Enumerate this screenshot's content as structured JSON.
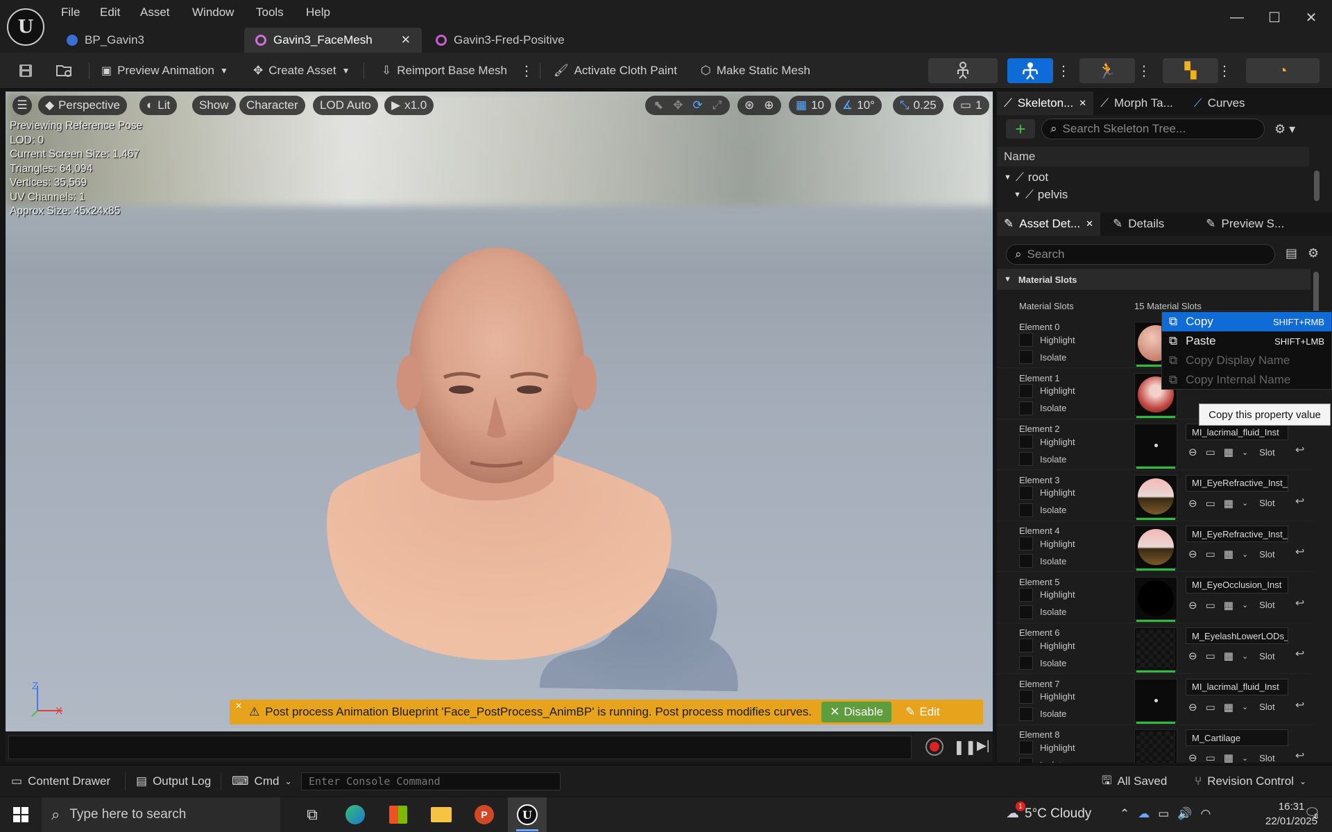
{
  "menu": {
    "file": "File",
    "edit": "Edit",
    "asset": "Asset",
    "window": "Window",
    "tools": "Tools",
    "help": "Help"
  },
  "tabs": [
    {
      "label": "BP_Gavin3"
    },
    {
      "label": "Gavin3_FaceMesh"
    },
    {
      "label": "Gavin3-Fred-Positive"
    }
  ],
  "toolbar": {
    "preview_animation": "Preview Animation",
    "create_asset": "Create Asset",
    "reimport": "Reimport Base Mesh",
    "cloth_paint": "Activate Cloth Paint",
    "static_mesh": "Make Static Mesh"
  },
  "viewport": {
    "perspective": "Perspective",
    "lit": "Lit",
    "show": "Show",
    "character": "Character",
    "lod": "LOD Auto",
    "speed": "x1.0",
    "grid": "10",
    "angle": "10°",
    "scale": "0.25",
    "camera": "1",
    "stats": [
      "Previewing Reference Pose",
      "LOD: 0",
      "Current Screen Size: 1.467",
      "Triangles: 64,094",
      "Vertices: 35,569",
      "UV Channels: 1",
      "Approx Size: 45x24x85"
    ],
    "notification": "Post process Animation Blueprint 'Face_PostProcess_AnimBP' is running. Post process modifies curves.",
    "disable": "Disable",
    "edit": "Edit",
    "axis_x": "X",
    "axis_z": "Z"
  },
  "skeleton": {
    "tab1": "Skeleton...",
    "tab2": "Morph Ta...",
    "tab3": "Curves",
    "search_placeholder": "Search Skeleton Tree...",
    "name_header": "Name",
    "bones": [
      "root",
      "pelvis"
    ]
  },
  "details": {
    "tab1": "Asset Det...",
    "tab2": "Details",
    "tab3": "Preview S...",
    "search_placeholder": "Search",
    "section": "Material Slots",
    "slots_label": "Material Slots",
    "slots_value": "15 Material Slots",
    "highlight": "Highlight",
    "isolate": "Isolate",
    "slot": "Slot",
    "elements": [
      {
        "label": "Element 0",
        "material": ""
      },
      {
        "label": "Element 1",
        "material": ""
      },
      {
        "label": "Element 2",
        "material": "MI_lacrimal_fluid_Inst"
      },
      {
        "label": "Element 3",
        "material": "MI_EyeRefractive_Inst_L"
      },
      {
        "label": "Element 4",
        "material": "MI_EyeRefractive_Inst_R"
      },
      {
        "label": "Element 5",
        "material": "MI_EyeOcclusion_Inst"
      },
      {
        "label": "Element 6",
        "material": "M_EyelashLowerLODs_I"
      },
      {
        "label": "Element 7",
        "material": "MI_lacrimal_fluid_Inst"
      },
      {
        "label": "Element 8",
        "material": "M_Cartilage"
      }
    ]
  },
  "context_menu": {
    "copy": "Copy",
    "copy_sc": "SHIFT+RMB",
    "paste": "Paste",
    "paste_sc": "SHIFT+LMB",
    "copy_display": "Copy Display Name",
    "copy_internal": "Copy Internal Name",
    "tooltip": "Copy this property value"
  },
  "statusbar": {
    "content_drawer": "Content Drawer",
    "output_log": "Output Log",
    "cmd": "Cmd",
    "console_placeholder": "Enter Console Command",
    "all_saved": "All Saved",
    "revision": "Revision Control"
  },
  "taskbar": {
    "search": "Type here to search",
    "weather": "5°C  Cloudy",
    "time": "16:31",
    "date": "22/01/2025",
    "notif": "8",
    "weather_badge": "1"
  },
  "colors": {
    "accent": "#0f6cd6",
    "notify": "#e8a31c",
    "green": "#2ebd3f"
  }
}
